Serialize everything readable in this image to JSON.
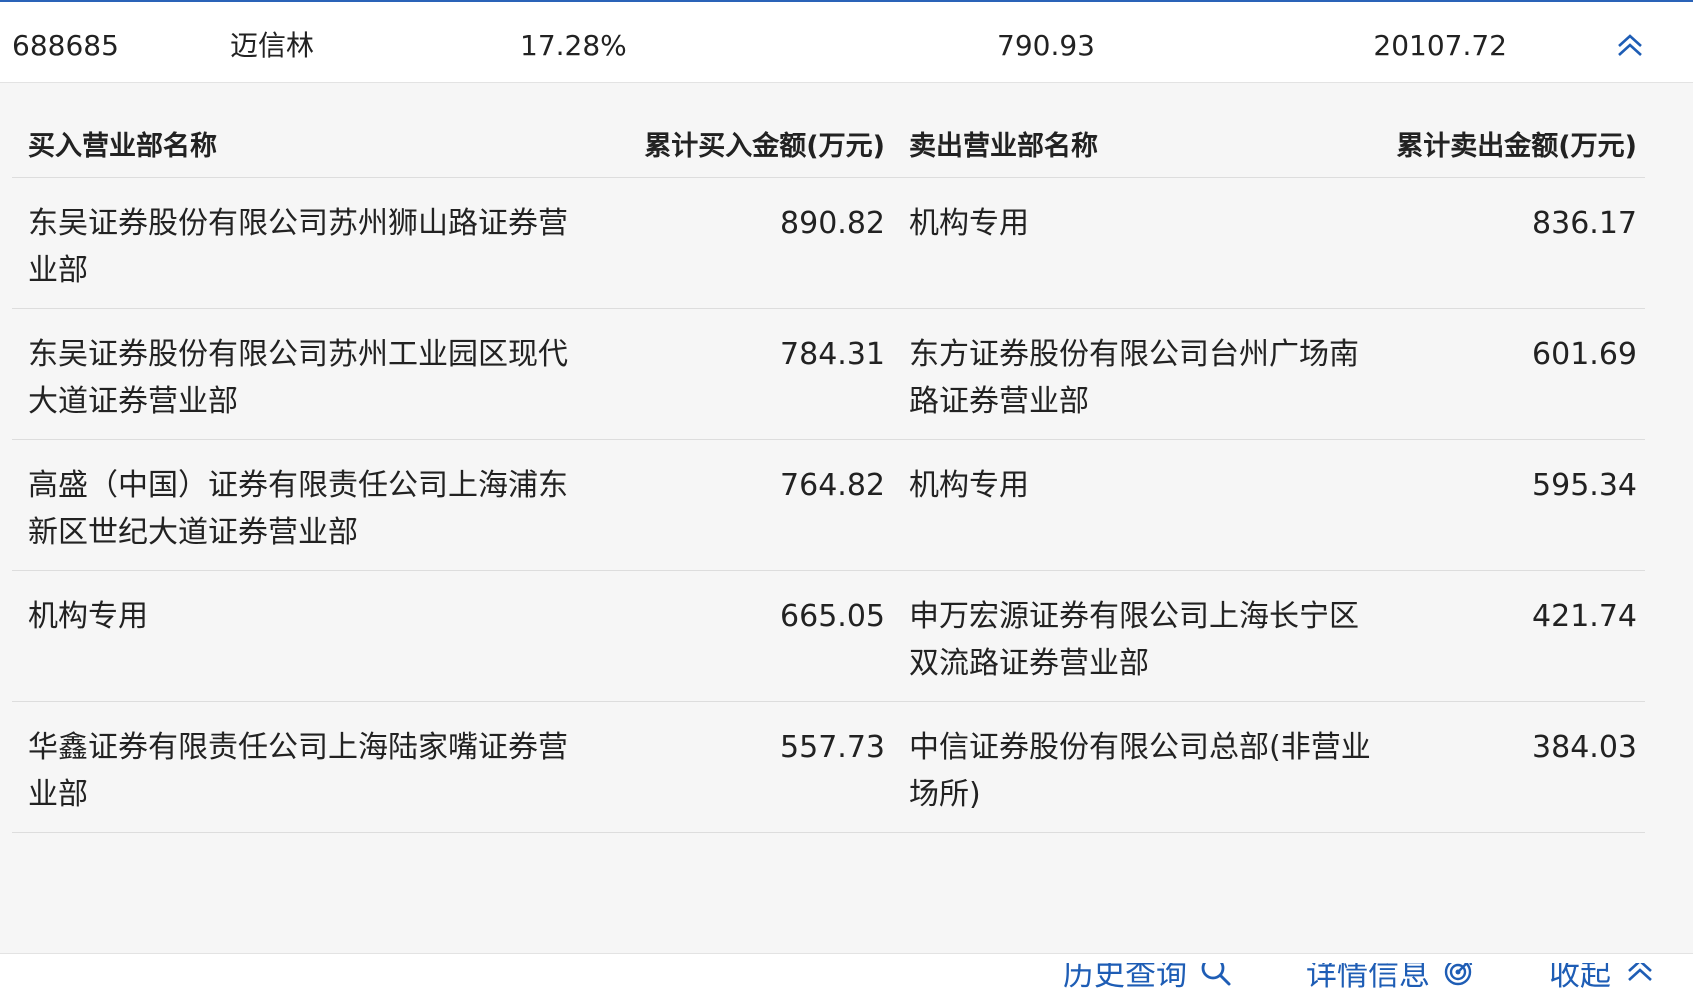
{
  "summary": {
    "code": "688685",
    "name": "迈信林",
    "pct": "17.28%",
    "buy_total": "790.93",
    "sell_total": "20107.72"
  },
  "table": {
    "headers": {
      "buy_name": "买入营业部名称",
      "buy_amount": "累计买入金额(万元)",
      "sell_name": "卖出营业部名称",
      "sell_amount": "累计卖出金额(万元)"
    },
    "rows": [
      {
        "buy_name": "东吴证券股份有限公司苏州狮山路证券营业部",
        "buy_amount": "890.82",
        "sell_name": "机构专用",
        "sell_amount": "836.17"
      },
      {
        "buy_name": "东吴证券股份有限公司苏州工业园区现代大道证券营业部",
        "buy_amount": "784.31",
        "sell_name": "东方证券股份有限公司台州广场南路证券营业部",
        "sell_amount": "601.69"
      },
      {
        "buy_name": "高盛（中国）证券有限责任公司上海浦东新区世纪大道证券营业部",
        "buy_amount": "764.82",
        "sell_name": "机构专用",
        "sell_amount": "595.34"
      },
      {
        "buy_name": "机构专用",
        "buy_amount": "665.05",
        "sell_name": "申万宏源证券有限公司上海长宁区双流路证券营业部",
        "sell_amount": "421.74"
      },
      {
        "buy_name": "华鑫证券有限责任公司上海陆家嘴证券营业部",
        "buy_amount": "557.73",
        "sell_name": "中信证券股份有限公司总部(非营业场所)",
        "sell_amount": "384.03"
      }
    ]
  },
  "actions": {
    "history": "历史查询",
    "detail": "详情信息",
    "collapse": "收起"
  },
  "icons": {
    "history": "search-icon",
    "detail": "target-icon",
    "collapse": "double-chevron-up-icon"
  },
  "colors": {
    "accent": "#1e5db5",
    "panel": "#f6f6f6"
  }
}
